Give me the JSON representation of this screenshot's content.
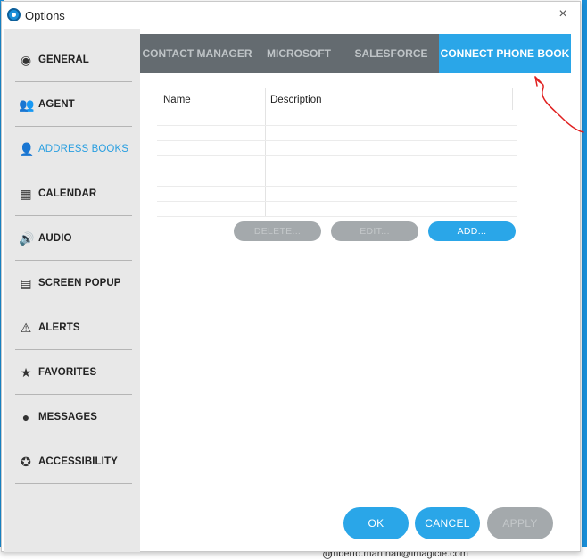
{
  "window": {
    "title": "Options",
    "close_glyph": "×"
  },
  "sidebar": {
    "items": [
      {
        "label": "GENERAL",
        "icon": "general-icon",
        "glyph": "◉"
      },
      {
        "label": "AGENT",
        "icon": "agent-icon",
        "glyph": "👥"
      },
      {
        "label": "ADDRESS BOOKS",
        "icon": "address-books-icon",
        "glyph": "👤"
      },
      {
        "label": "CALENDAR",
        "icon": "calendar-icon",
        "glyph": "▦"
      },
      {
        "label": "AUDIO",
        "icon": "audio-icon",
        "glyph": "🔊"
      },
      {
        "label": "SCREEN POPUP",
        "icon": "screen-popup-icon",
        "glyph": "▤"
      },
      {
        "label": "ALERTS",
        "icon": "alerts-icon",
        "glyph": "⚠"
      },
      {
        "label": "FAVORITES",
        "icon": "favorites-icon",
        "glyph": "★"
      },
      {
        "label": "MESSAGES",
        "icon": "messages-icon",
        "glyph": "●"
      },
      {
        "label": "ACCESSIBILITY",
        "icon": "accessibility-icon",
        "glyph": "✪"
      }
    ],
    "active_index": 2
  },
  "tabs": [
    {
      "label": "CONTACT MANAGER"
    },
    {
      "label": "MICROSOFT"
    },
    {
      "label": "SALESFORCE"
    },
    {
      "label": "CONNECT PHONE BOOK"
    }
  ],
  "table": {
    "columns": [
      "Name",
      "Description"
    ],
    "rows": []
  },
  "actions": {
    "delete": "DELETE...",
    "edit": "EDIT...",
    "add": "ADD..."
  },
  "footer": {
    "ok": "OK",
    "cancel": "CANCEL",
    "apply": "APPLY"
  },
  "background": {
    "email": "umberto.martinati@imagicle.com"
  },
  "colors": {
    "accent": "#2aa6e8",
    "tab_bar": "#646b70",
    "sidebar": "#e8e8e8",
    "disabled": "#a4a9ac",
    "annotation": "#e02020"
  }
}
